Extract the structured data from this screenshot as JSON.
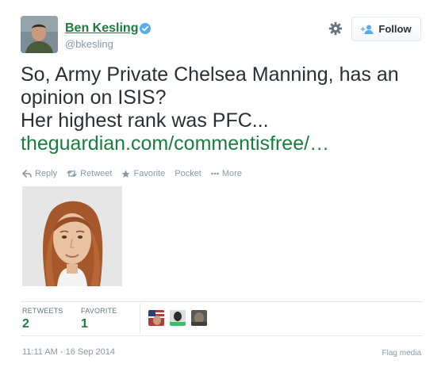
{
  "author": {
    "display_name": "Ben Kesling",
    "handle": "@bkesling",
    "verified_icon": "verified-badge-icon",
    "avatar_icon": "avatar-photo"
  },
  "header": {
    "settings_icon": "gear-icon",
    "follow_label": "Follow",
    "follow_icon": "add-user-icon"
  },
  "tweet": {
    "line1": "So, Army Private Chelsea Manning, has an",
    "line2": "opinion on ISIS?",
    "line3": "Her highest rank was PFC...",
    "link_text": "theguardian.com/commentisfree/…"
  },
  "actions": {
    "reply": "Reply",
    "retweet": "Retweet",
    "favorite": "Favorite",
    "pocket": "Pocket",
    "more": "More"
  },
  "media": {
    "icon": "portrait-illustration"
  },
  "stats": {
    "retweets_label": "RETWEETS",
    "retweets_count": "2",
    "favorites_label": "FAVORITE",
    "favorites_count": "1"
  },
  "footer": {
    "timestamp": "11:11 AM - 16 Sep 2014",
    "flag_label": "Flag media"
  },
  "colors": {
    "accent": "#1a7d3f",
    "muted": "#8899a6",
    "text": "#292f33",
    "verified": "#55acee",
    "border": "#e1e8ed"
  }
}
